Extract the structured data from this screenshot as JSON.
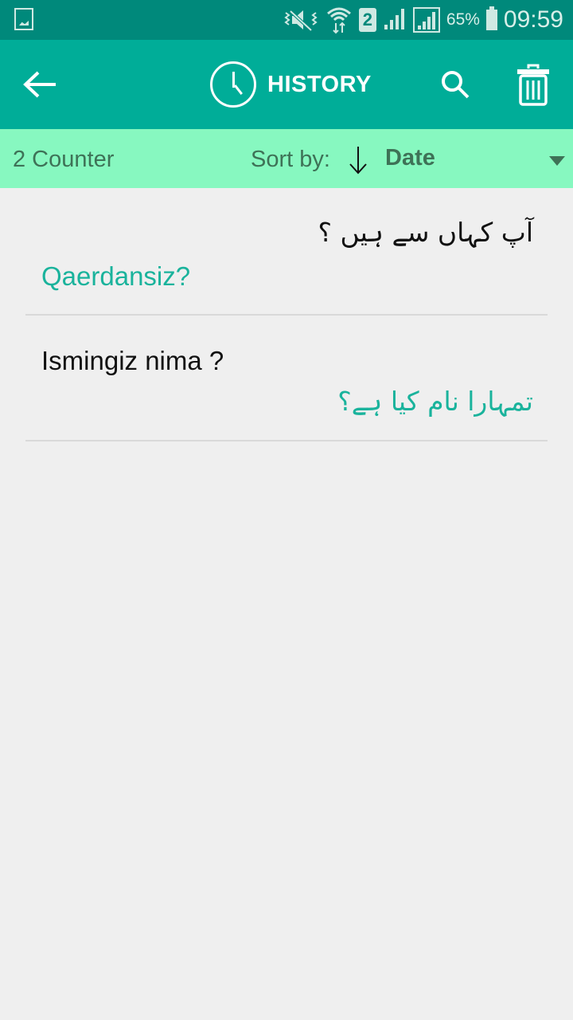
{
  "status_bar": {
    "battery": "65%",
    "time": "09:59",
    "sim_slot": "2",
    "icons": [
      "gallery-icon",
      "vibrate-mute-icon",
      "wifi-icon",
      "sim-2-icon",
      "signal-icon",
      "signal-icon",
      "battery-charging-icon"
    ]
  },
  "toolbar": {
    "title": "HISTORY",
    "icons": {
      "back": "arrow-left-icon",
      "clock": "clock-icon",
      "search": "search-icon",
      "delete": "trash-icon"
    }
  },
  "sortbar": {
    "counter": "2 Counter",
    "sort_label": "Sort by:",
    "sort_value": "Date",
    "direction_icon": "arrow-down-icon"
  },
  "history": [
    {
      "source": "آپ کہاں سے ہیں ؟",
      "source_dir": "rtl",
      "translation": "Qaerdansiz?",
      "translation_dir": "ltr"
    },
    {
      "source": "Ismingiz nima ?",
      "source_dir": "ltr",
      "translation": "تمہارا نام کیا ہے؟",
      "translation_dir": "rtl"
    }
  ],
  "colors": {
    "status": "#00897b",
    "toolbar": "#00ad98",
    "sortbar": "#87f8c0",
    "accent_text": "#1ab39c",
    "background": "#efefef"
  }
}
